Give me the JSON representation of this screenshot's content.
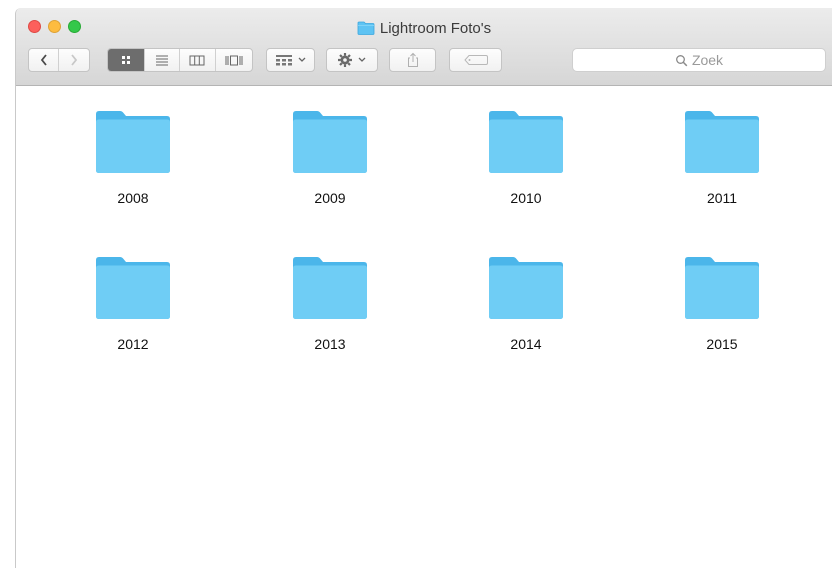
{
  "window": {
    "title": "Lightroom Foto's"
  },
  "toolbar": {
    "back_icon": "chevron-left-icon",
    "forward_icon": "chevron-right-icon",
    "view_modes": [
      "icon-view-icon",
      "list-view-icon",
      "column-view-icon",
      "coverflow-view-icon"
    ],
    "active_view": "icon",
    "arrange_icon": "arrange-grid-icon",
    "action_icon": "gear-icon",
    "share_icon": "share-icon",
    "tag_icon": "tag-icon"
  },
  "search": {
    "placeholder": "Zoek"
  },
  "folders": [
    {
      "name": "2008"
    },
    {
      "name": "2009"
    },
    {
      "name": "2010"
    },
    {
      "name": "2011"
    },
    {
      "name": "2012"
    },
    {
      "name": "2013"
    },
    {
      "name": "2014"
    },
    {
      "name": "2015"
    }
  ],
  "colors": {
    "folder_light": "#6fcdf5",
    "folder_dark": "#4bb6ea",
    "selected_view": "#6d6d6d"
  }
}
